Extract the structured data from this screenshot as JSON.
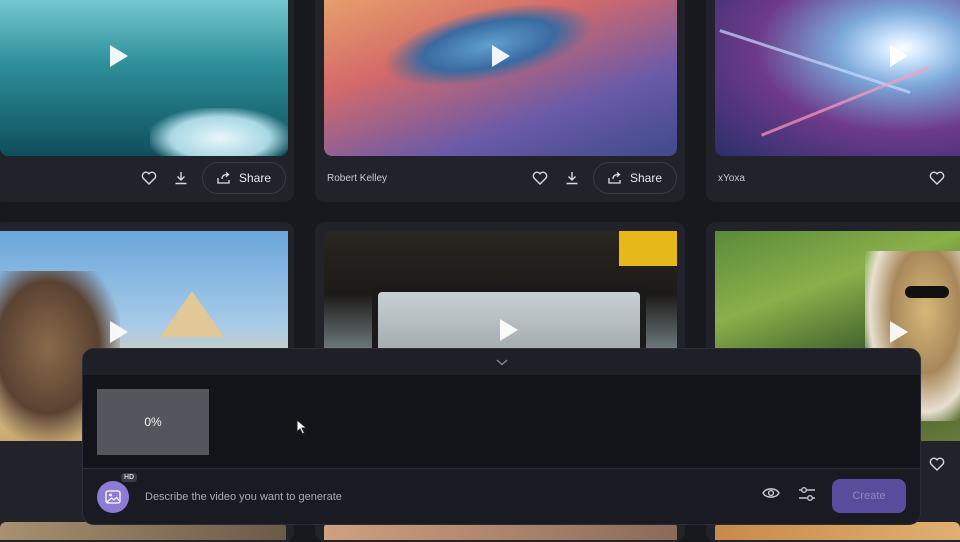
{
  "gallery": {
    "cards": [
      {
        "id": "underwater",
        "author": "",
        "share_label": "Share",
        "show_share": true,
        "theme": "water"
      },
      {
        "id": "dragon",
        "author": "Robert Kelley",
        "share_label": "Share",
        "show_share": true,
        "theme": "sky"
      },
      {
        "id": "lightspeed",
        "author": "xYoxa",
        "share_label": "",
        "show_share": false,
        "theme": "speed"
      },
      {
        "id": "bull",
        "author": "",
        "share_label": "",
        "show_share": false,
        "theme": "desert"
      },
      {
        "id": "bus",
        "author": "",
        "share_label": "",
        "show_share": false,
        "theme": "bus"
      },
      {
        "id": "palm",
        "author": "",
        "share_label": "",
        "show_share": false,
        "theme": "palm"
      }
    ]
  },
  "generator": {
    "progress_value": 0,
    "progress_label": "0%",
    "hd_badge": "HD",
    "prompt_placeholder": "Describe the video you want to generate",
    "prompt_value": "",
    "create_label": "Create"
  },
  "icons": {
    "collapse": "chevron-down-icon",
    "like": "heart-icon",
    "download": "download-icon",
    "share": "share-icon",
    "play": "play-icon",
    "image_upload": "image-icon",
    "preview": "eye-icon",
    "settings": "sliders-icon"
  },
  "colors": {
    "background": "#18181f",
    "card": "#22222b",
    "accent": "#8c7cd6",
    "create_button": "#5a4c9c"
  }
}
